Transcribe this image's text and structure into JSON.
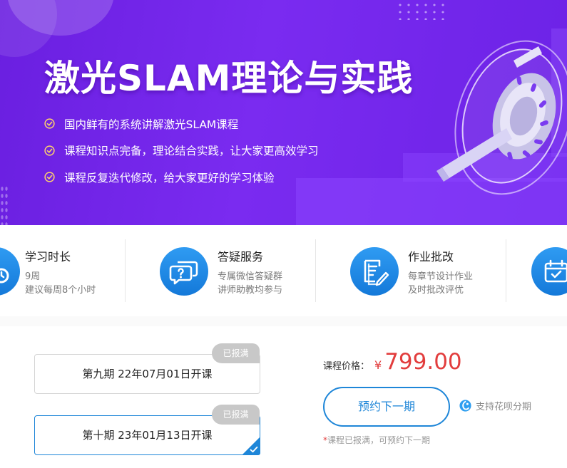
{
  "banner": {
    "title": "激光SLAM理论与实践",
    "features": [
      "国内鲜有的系统讲解激光SLAM课程",
      "课程知识点完备，理论结合实践，让大家更高效学习",
      "课程反复迭代修改，给大家更好的学习体验"
    ]
  },
  "services": [
    {
      "title": "学习时长",
      "line1": "9周",
      "line2": "建议每周8个小时",
      "icon": "clock-icon"
    },
    {
      "title": "答疑服务",
      "line1": "专属微信答疑群",
      "line2": "讲师助教均参与",
      "icon": "chat-question-icon"
    },
    {
      "title": "作业批改",
      "line1": "每章节设计作业",
      "line2": "及时批改评优",
      "icon": "document-edit-icon"
    },
    {
      "title": "",
      "line1": "",
      "line2": "",
      "icon": "calendar-check-icon"
    }
  ],
  "sessions": [
    {
      "label": "第九期 22年07月01日开课",
      "tag": "已报满",
      "selected": false
    },
    {
      "label": "第十期 23年01月13日开课",
      "tag": "已报满",
      "selected": true
    }
  ],
  "purchase": {
    "price_label": "课程价格：",
    "currency": "¥",
    "price": "799.00",
    "reserve_button": "预约下一期",
    "installment_label": "支持花呗分期",
    "notice_star": "*",
    "notice": "课程已报满，可预约下一期"
  },
  "colors": {
    "banner": "#7a2bf0",
    "accent_blue": "#1e86d8",
    "price_red": "#e23d3d",
    "tag_gray": "#c8c8c8"
  }
}
